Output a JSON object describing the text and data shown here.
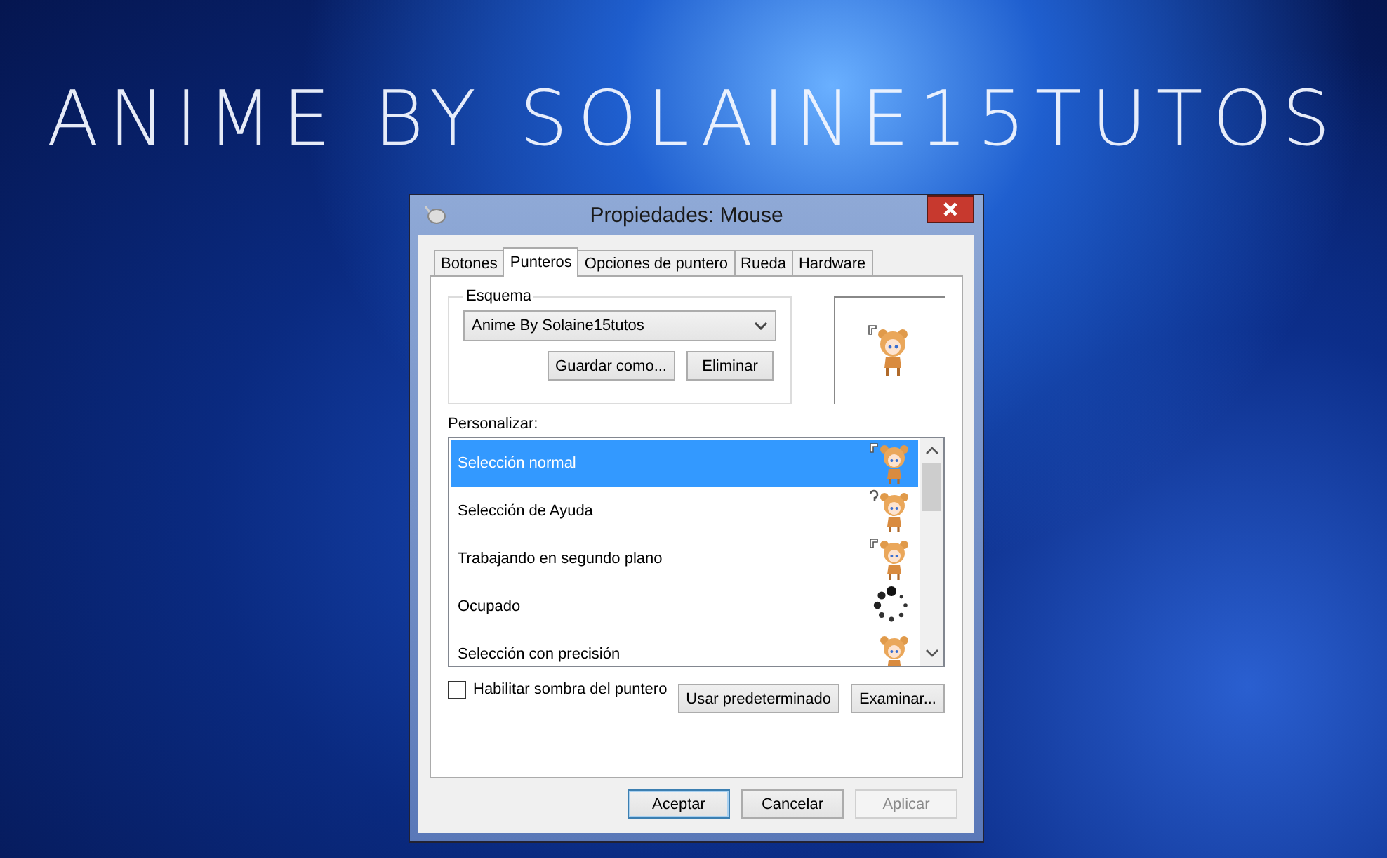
{
  "wallpaper_title": "ANIME BY SOLAINE15TUTOS",
  "window": {
    "title": "Propiedades: Mouse"
  },
  "tabs": [
    {
      "label": "Botones",
      "selected": false
    },
    {
      "label": "Punteros",
      "selected": true
    },
    {
      "label": "Opciones de puntero",
      "selected": false
    },
    {
      "label": "Rueda",
      "selected": false
    },
    {
      "label": "Hardware",
      "selected": false
    }
  ],
  "scheme": {
    "label": "Esquema",
    "value": "Anime By Solaine15tutos",
    "buttons": [
      "Guardar como...",
      "Eliminar"
    ]
  },
  "customize": {
    "label": "Personalizar:",
    "rows": [
      {
        "label": "Selección normal",
        "kind": "arrow",
        "selected": true
      },
      {
        "label": "Selección de Ayuda",
        "kind": "help",
        "selected": false
      },
      {
        "label": "Trabajando en segundo plano",
        "kind": "working",
        "selected": false
      },
      {
        "label": "Ocupado",
        "kind": "busy",
        "selected": false
      },
      {
        "label": "Selección con precisión",
        "kind": "precision",
        "selected": false
      }
    ]
  },
  "shadow_checkbox": {
    "label": "Habilitar sombra del puntero",
    "checked": false
  },
  "list_buttons": [
    "Usar predeterminado",
    "Examinar..."
  ],
  "footer_buttons": [
    {
      "label": "Aceptar",
      "default": true,
      "disabled": false
    },
    {
      "label": "Cancelar",
      "default": false,
      "disabled": false
    },
    {
      "label": "Aplicar",
      "default": false,
      "disabled": true
    }
  ]
}
